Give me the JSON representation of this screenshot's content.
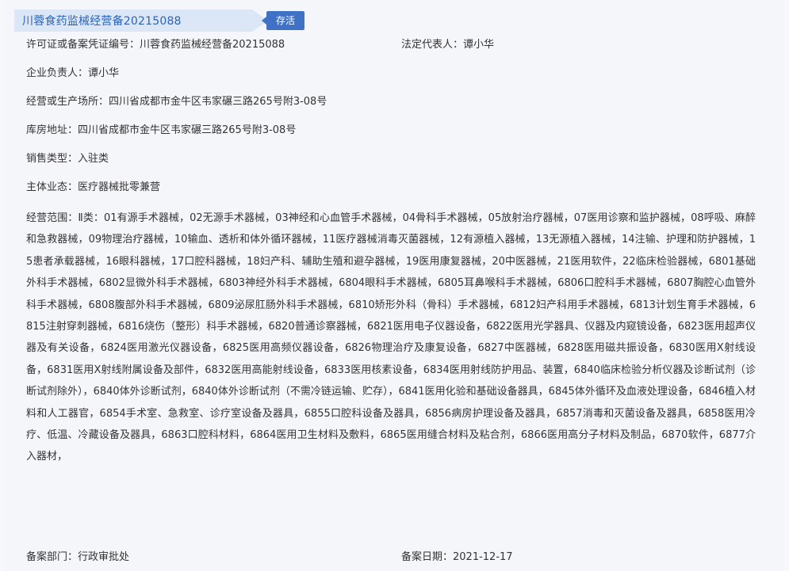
{
  "header": {
    "title": "川蓉食药监械经营备20215088",
    "status": "存活"
  },
  "fields": {
    "license_label": "许可证或备案凭证编号：",
    "license_value": "川蓉食药监械经营备20215088",
    "legal_rep_label": "法定代表人：",
    "legal_rep_value": "谭小华",
    "principal_label": "企业负责人：",
    "principal_value": "谭小华",
    "premises_label": "经营或生产场所：",
    "premises_value": "四川省成都市金牛区韦家碾三路265号附3-08号",
    "warehouse_label": "库房地址：",
    "warehouse_value": "四川省成都市金牛区韦家碾三路265号附3-08号",
    "sales_type_label": "销售类型：",
    "sales_type_value": "入驻类",
    "business_label": "主体业态：",
    "business_value": "医疗器械批零兼营",
    "scope_label": "经营范围：",
    "scope_value": "Ⅱ类：01有源手术器械，02无源手术器械，03神经和心血管手术器械，04骨科手术器械，05放射治疗器械，07医用诊察和监护器械，08呼吸、麻醉和急救器械，09物理治疗器械，10输血、透析和体外循环器械，11医疗器械消毒灭菌器械，12有源植入器械，13无源植入器械，14注输、护理和防护器械，15患者承载器械，16眼科器械，17口腔科器械，18妇产科、辅助生殖和避孕器械，19医用康复器械，20中医器械，21医用软件，22临床检验器械，6801基础外科手术器械，6802显微外科手术器械，6803神经外科手术器械，6804眼科手术器械，6805耳鼻喉科手术器械，6806口腔科手术器械，6807胸腔心血管外科手术器械，6808腹部外科手术器械，6809泌尿肛肠外科手术器械，6810矫形外科（骨科）手术器械，6812妇产科用手术器械，6813计划生育手术器械，6815注射穿刺器械，6816烧伤（整形）科手术器械，6820普通诊察器械，6821医用电子仪器设备，6822医用光学器具、仪器及内窥镜设备，6823医用超声仪器及有关设备，6824医用激光仪器设备，6825医用高频仪器设备，6826物理治疗及康复设备，6827中医器械，6828医用磁共振设备，6830医用X射线设备，6831医用X射线附属设备及部件，6832医用高能射线设备，6833医用核素设备，6834医用射线防护用品、装置，6840临床检验分析仪器及诊断试剂（诊断试剂除外），6840体外诊断试剂，6840体外诊断试剂（不需冷链运输、贮存），6841医用化验和基础设备器具，6845体外循环及血液处理设备，6846植入材料和人工器官，6854手术室、急救室、诊疗室设备及器具，6855口腔科设备及器具，6856病房护理设备及器具，6857消毒和灭菌设备及器具，6858医用冷疗、低温、冷藏设备及器具，6863口腔科材料，6864医用卫生材料及敷料，6865医用缝合材料及粘合剂，6866医用高分子材料及制品，6870软件，6877介入器材，",
    "dept_label": "备案部门：",
    "dept_value": "行政审批处",
    "date_label": "备案日期：",
    "date_value": "2021-12-17"
  },
  "colors": {
    "title_bg": "#dbe7f7",
    "title_text": "#2b63b8",
    "badge_bg": "#3f72c6"
  }
}
